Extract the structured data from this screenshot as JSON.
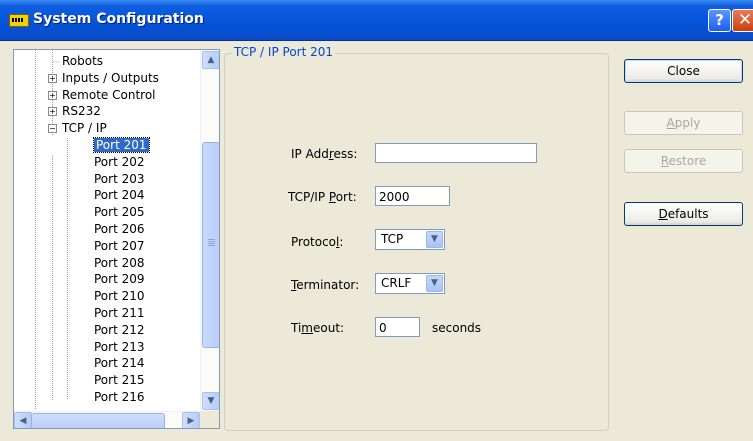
{
  "window": {
    "title": "System Configuration",
    "help_glyph": "?",
    "close_glyph": "✕"
  },
  "tree": {
    "items": [
      {
        "label": "Robots",
        "level": 1,
        "expander": ""
      },
      {
        "label": "Inputs / Outputs",
        "level": 1,
        "expander": "+"
      },
      {
        "label": "Remote Control",
        "level": 1,
        "expander": "+"
      },
      {
        "label": "RS232",
        "level": 1,
        "expander": "+"
      },
      {
        "label": "TCP / IP",
        "level": 1,
        "expander": "−"
      },
      {
        "label": "Port 201",
        "level": 2,
        "selected": true
      },
      {
        "label": "Port 202",
        "level": 2
      },
      {
        "label": "Port 203",
        "level": 2
      },
      {
        "label": "Port 204",
        "level": 2
      },
      {
        "label": "Port 205",
        "level": 2
      },
      {
        "label": "Port 206",
        "level": 2
      },
      {
        "label": "Port 207",
        "level": 2
      },
      {
        "label": "Port 208",
        "level": 2
      },
      {
        "label": "Port 209",
        "level": 2
      },
      {
        "label": "Port 210",
        "level": 2
      },
      {
        "label": "Port 211",
        "level": 2
      },
      {
        "label": "Port 212",
        "level": 2
      },
      {
        "label": "Port 213",
        "level": 2
      },
      {
        "label": "Port 214",
        "level": 2
      },
      {
        "label": "Port 215",
        "level": 2
      },
      {
        "label": "Port 216",
        "level": 2
      }
    ]
  },
  "group": {
    "legend": "TCP / IP Port 201",
    "ip_label_pre": "IP Add",
    "ip_label_u": "r",
    "ip_label_post": "ess:",
    "ip_value": "",
    "port_label_pre": "TCP/IP ",
    "port_label_u": "P",
    "port_label_post": "ort:",
    "port_value": "2000",
    "protocol_label_pre": "Protoco",
    "protocol_label_u": "l",
    "protocol_label_post": ":",
    "protocol_value": "TCP",
    "terminator_label_pre": "",
    "terminator_label_u": "T",
    "terminator_label_post": "erminator:",
    "terminator_value": "CRLF",
    "timeout_label_pre": "Ti",
    "timeout_label_u": "m",
    "timeout_label_post": "eout:",
    "timeout_value": "0",
    "timeout_units": "seconds"
  },
  "buttons": {
    "close": "Close",
    "apply_u": "A",
    "apply_rest": "pply",
    "restore_u": "R",
    "restore_rest": "estore",
    "defaults_u": "D",
    "defaults_rest": "efaults"
  },
  "colors": {
    "titlebar": "#0553d8",
    "selection": "#316ac5",
    "group_legend": "#0046d5"
  },
  "icons": {
    "scroll_up": "▲",
    "scroll_down": "▼",
    "scroll_left": "◀",
    "scroll_right": "▶",
    "dropdown": "▼"
  }
}
